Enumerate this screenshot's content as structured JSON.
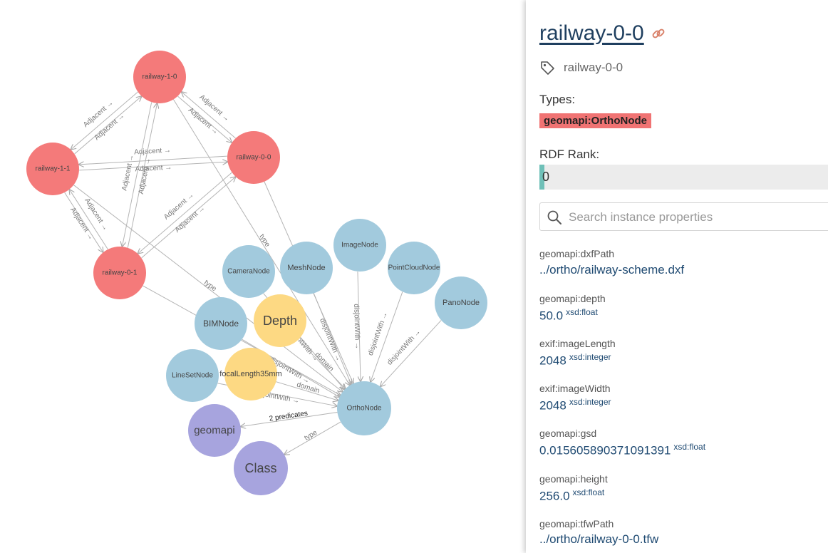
{
  "graph": {
    "nodes": [
      {
        "id": "railway-1-0",
        "label": "railway-1-0",
        "group": "instance"
      },
      {
        "id": "railway-1-1",
        "label": "railway-1-1",
        "group": "instance"
      },
      {
        "id": "railway-0-0",
        "label": "railway-0-0",
        "group": "instance"
      },
      {
        "id": "railway-0-1",
        "label": "railway-0-1",
        "group": "instance"
      },
      {
        "id": "CameraNode",
        "label": "CameraNode",
        "group": "class"
      },
      {
        "id": "MeshNode",
        "label": "MeshNode",
        "group": "class"
      },
      {
        "id": "ImageNode",
        "label": "ImageNode",
        "group": "class"
      },
      {
        "id": "PointCloudNode",
        "label": "PointCloudNode",
        "group": "class"
      },
      {
        "id": "PanoNode",
        "label": "PanoNode",
        "group": "class"
      },
      {
        "id": "BIMNode",
        "label": "BIMNode",
        "group": "class"
      },
      {
        "id": "LineSetNode",
        "label": "LineSetNode",
        "group": "class"
      },
      {
        "id": "OrthoNode",
        "label": "OrthoNode",
        "group": "class"
      },
      {
        "id": "Depth",
        "label": "Depth",
        "group": "property"
      },
      {
        "id": "FocalLength35mm",
        "label": "focalLength35mm",
        "group": "property"
      },
      {
        "id": "geomapi",
        "label": "geomapi",
        "group": "ontology"
      },
      {
        "id": "Class",
        "label": "Class",
        "group": "ontology"
      }
    ],
    "edges": [
      {
        "from": "railway-1-0",
        "to": "railway-1-1",
        "label": "Adjacent →",
        "bidirectional": true
      },
      {
        "from": "railway-1-1",
        "to": "railway-1-0",
        "label": "Adjacent →",
        "bidirectional": true
      },
      {
        "from": "railway-1-0",
        "to": "railway-0-0",
        "label": "Adjacent →",
        "bidirectional": true
      },
      {
        "from": "railway-0-0",
        "to": "railway-1-0",
        "label": "Adjacent →",
        "bidirectional": true
      },
      {
        "from": "railway-1-1",
        "to": "railway-0-0",
        "label": "Adjacent →",
        "bidirectional": true
      },
      {
        "from": "railway-0-0",
        "to": "railway-1-1",
        "label": "Adjacent →",
        "bidirectional": true
      },
      {
        "from": "railway-1-0",
        "to": "railway-0-1",
        "label": "Adjacent →",
        "bidirectional": true
      },
      {
        "from": "railway-0-1",
        "to": "railway-1-0",
        "label": "Adjacent →",
        "bidirectional": true
      },
      {
        "from": "railway-1-1",
        "to": "railway-0-1",
        "label": "Adjacent →",
        "bidirectional": true
      },
      {
        "from": "railway-0-1",
        "to": "railway-1-1",
        "label": "Adjacent →",
        "bidirectional": true
      },
      {
        "from": "railway-0-0",
        "to": "railway-0-1",
        "label": "Adjacent →",
        "bidirectional": true
      },
      {
        "from": "railway-0-1",
        "to": "railway-0-0",
        "label": "Adjacent →",
        "bidirectional": true
      },
      {
        "from": "railway-1-0",
        "to": "OrthoNode",
        "label": "type"
      },
      {
        "from": "railway-1-1",
        "to": "OrthoNode",
        "label": "type"
      },
      {
        "from": "railway-0-0",
        "to": "OrthoNode",
        "label": ""
      },
      {
        "from": "railway-0-1",
        "to": "OrthoNode",
        "label": ""
      },
      {
        "from": "CameraNode",
        "to": "OrthoNode",
        "label": "disjointWith →",
        "bidirectional": true
      },
      {
        "from": "MeshNode",
        "to": "OrthoNode",
        "label": "disjointWith →",
        "bidirectional": true
      },
      {
        "from": "ImageNode",
        "to": "OrthoNode",
        "label": "disjointWith →",
        "bidirectional": true
      },
      {
        "from": "PointCloudNode",
        "to": "OrthoNode",
        "label": "disjointWith →",
        "bidirectional": true
      },
      {
        "from": "PanoNode",
        "to": "OrthoNode",
        "label": "disjointWith →",
        "bidirectional": true
      },
      {
        "from": "BIMNode",
        "to": "OrthoNode",
        "label": "disjointWith →",
        "bidirectional": true
      },
      {
        "from": "LineSetNode",
        "to": "OrthoNode",
        "label": "disjointWith →",
        "bidirectional": true
      },
      {
        "from": "Depth",
        "to": "OrthoNode",
        "label": "domain"
      },
      {
        "from": "FocalLength35mm",
        "to": "OrthoNode",
        "label": "domain"
      },
      {
        "from": "OrthoNode",
        "to": "geomapi",
        "label": "2 predicates"
      },
      {
        "from": "OrthoNode",
        "to": "Class",
        "label": "type"
      }
    ],
    "colors": {
      "instance": "#f47a7a",
      "class": "#a2cadd",
      "property": "#fdd983",
      "ontology": "#a7a4de",
      "edge": "#b4b4b4"
    }
  },
  "panel": {
    "title": "railway-0-0",
    "label": "railway-0-0",
    "types_label": "Types:",
    "type_badge": "geomapi:OrthoNode",
    "type_badge_color": "#f07373",
    "rdf_rank_label": "RDF Rank:",
    "rdf_rank_value": "0",
    "search_placeholder": "Search instance properties",
    "properties": [
      {
        "name": "geomapi:dxfPath",
        "value": "../ortho/railway-scheme.dxf",
        "datatype": ""
      },
      {
        "name": "geomapi:depth",
        "value": "50.0",
        "datatype": "xsd:float"
      },
      {
        "name": "exif:imageLength",
        "value": "2048",
        "datatype": "xsd:integer"
      },
      {
        "name": "exif:imageWidth",
        "value": "2048",
        "datatype": "xsd:integer"
      },
      {
        "name": "geomapi:gsd",
        "value": "0.015605890371091391",
        "datatype": "xsd:float"
      },
      {
        "name": "geomapi:height",
        "value": "256.0",
        "datatype": "xsd:float"
      },
      {
        "name": "geomapi:tfwPath",
        "value": "../ortho/railway-0-0.tfw",
        "datatype": ""
      }
    ]
  }
}
